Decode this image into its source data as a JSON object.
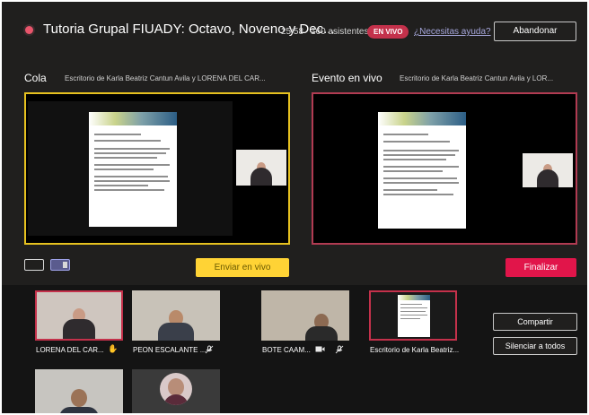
{
  "header": {
    "meeting_title": "Tutoria Grupal FIUADY: Octavo, Noveno y Dec...",
    "timer": "25:58",
    "attendees": "160 asistentes",
    "live_badge": "EN VIVO",
    "help_link": "¿Necesitas ayuda?",
    "leave_label": "Abandonar"
  },
  "queue": {
    "label": "Cola",
    "source": "Escritorio de Karla Beatriz Cantun Avila y LORENA DEL CAR..."
  },
  "live_event": {
    "label": "Evento en vivo",
    "source": "Escritorio de Karla Beatriz Cantun Avila y LOR..."
  },
  "actions": {
    "send_live_label": "Enviar en vivo",
    "end_label": "Finalizar",
    "share_label": "Compartir",
    "mute_all_label": "Silenciar a todos"
  },
  "participants": [
    {
      "name": "LORENA DEL CAR...",
      "icon": "hand-raised-icon",
      "glyph": "✋"
    },
    {
      "name": "PEON ESCALANTE ...",
      "icon": "mic-off-icon",
      "glyph": "🎙̸"
    },
    {
      "name": "BOTE CAAM...",
      "icon": "camera-icon",
      "glyph": "■"
    },
    {
      "name": "Escritorio de Karla Beatriz...",
      "icon": "",
      "glyph": ""
    }
  ],
  "colors": {
    "background": "#201f1e",
    "live_badge": "#c4314b",
    "queue_border": "#e6c11f",
    "live_border": "#b13b52",
    "send_live": "#ffd335",
    "end": "#e1154a"
  }
}
